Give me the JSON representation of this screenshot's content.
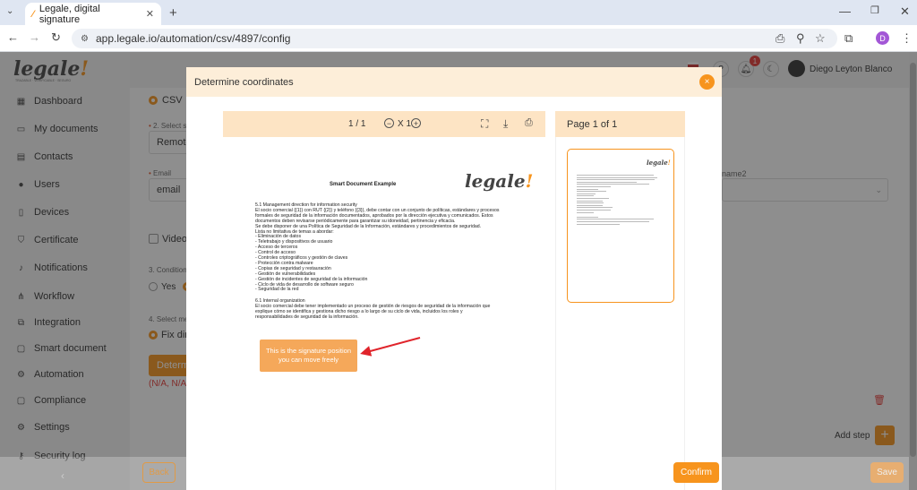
{
  "browser": {
    "tab_title": "Legale, digital signature",
    "url": "app.legale.io/automation/csv/4897/config",
    "profile_initial": "D"
  },
  "app": {
    "logo_text": "legale",
    "logo_tagline": "TRAZABLE · VERIFICABLE · SEGURO",
    "user_name": "Diego Leyton Blanco",
    "notification_count": "1",
    "sidebar": [
      {
        "label": "Dashboard",
        "icon": "dashboard-icon"
      },
      {
        "label": "My documents",
        "icon": "folder-icon"
      },
      {
        "label": "Contacts",
        "icon": "contacts-icon"
      },
      {
        "label": "Users",
        "icon": "user-icon"
      },
      {
        "label": "Devices",
        "icon": "tablet-icon"
      },
      {
        "label": "Certificate",
        "icon": "shield-icon"
      },
      {
        "label": "Notifications",
        "icon": "bell-icon"
      },
      {
        "label": "Workflow",
        "icon": "workflow-icon"
      },
      {
        "label": "Integration",
        "icon": "integration-icon"
      },
      {
        "label": "Smart document",
        "icon": "document-icon"
      },
      {
        "label": "Automation",
        "icon": "gear-icon"
      },
      {
        "label": "Compliance",
        "icon": "chat-icon"
      },
      {
        "label": "Settings",
        "icon": "settings-icon"
      },
      {
        "label": "Security log",
        "icon": "log-icon"
      }
    ],
    "form": {
      "csv_label": "CSV",
      "step2_label": "2. Select s",
      "step2_value": "Remote",
      "email_label": "Email",
      "email_value": "email",
      "video_label": "Video",
      "step3_label": "3. Condition",
      "yes_label": "Yes",
      "step4_label": "4. Select me",
      "fix_label": "Fix dire",
      "determine_label": "Determ",
      "coords_text": "(N/A, N/A,",
      "name2_label": "name2",
      "add_step_label": "Add step",
      "add_step_plus": "+",
      "back_label": "Back",
      "save_label": "Save"
    }
  },
  "modal": {
    "title": "Determine coordinates",
    "close": "×",
    "viewer": {
      "page_counter": "1 / 1",
      "zoom": "X 1",
      "thumb_header": "Page 1 of 1"
    },
    "document": {
      "title": "Smart Document Example",
      "logo": "legale",
      "lines": [
        "5.1 Management direction for information security",
        "El socio comercial {{1}} con RUT {{2}} y teléfono {{3}}, debe contar con un conjunto de políticas, estándares y procesos",
        "formales de seguridad de la información documentados, aprobados por la dirección ejecutiva y comunicados. Estos",
        "documentos deben revisarse periódicamente para garantizar su idoneidad, pertinencia y eficacia.",
        "Se debe disponer de una Política de Seguridad de la Información, estándares y procedimientos de seguridad.",
        "Lista no limitativa de temas a abordar:",
        "- Eliminación de datos",
        "- Teletrabajo y dispositivos de usuario",
        "- Acceso de terceros",
        "- Control de acceso",
        "- Controles criptográficos y gestión de claves",
        "- Protección contra malware",
        "- Copias de seguridad y restauración",
        "- Gestión de vulnerabilidades",
        "- Gestión de incidentes de seguridad de la información",
        "- Ciclo de vida de desarrollo de software seguro",
        "- Seguridad de la red",
        "",
        "6.1 Internal organization",
        "El socio comercial debe tener implementado un proceso de gestión de riesgos de seguridad de la información que",
        "explique cómo se identifica y gestiona dicho riesgo a lo largo de su ciclo de vida, incluidos los roles y",
        "responsabilidades de seguridad de la información."
      ],
      "signature_hint": "This is the signature position you can move freely"
    },
    "confirm_label": "Confirm"
  },
  "colors": {
    "accent": "#f7941d",
    "header_bg": "#fdeed9",
    "toolbar_bg": "#fde4c4",
    "arrow": "#e0242b"
  }
}
